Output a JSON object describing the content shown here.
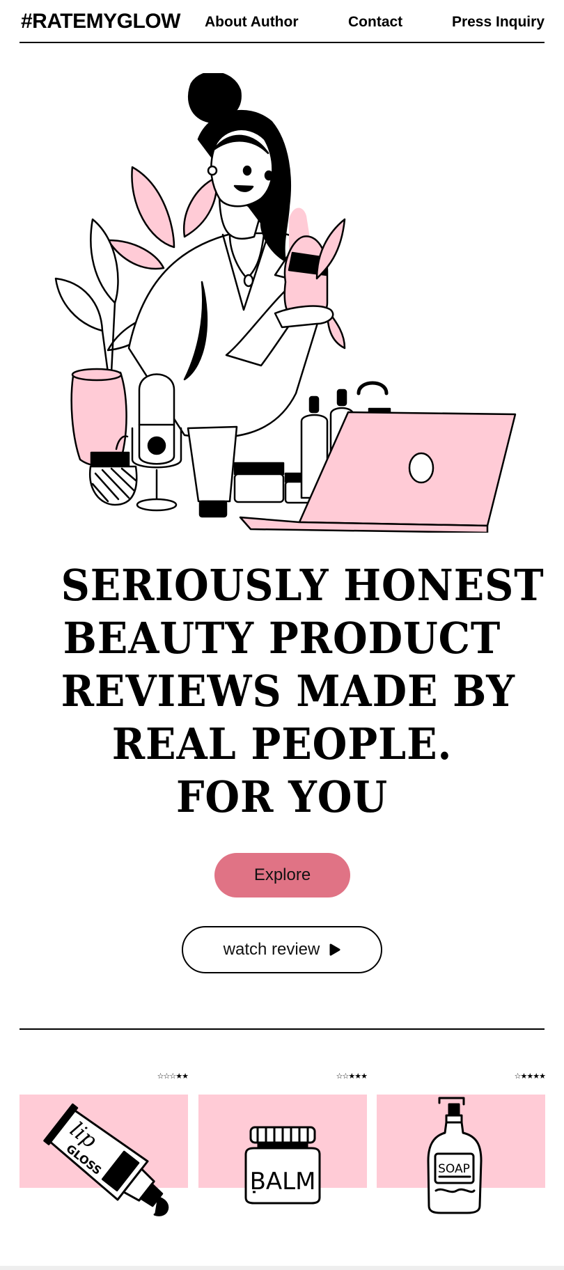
{
  "header": {
    "brand": "#RATEMYGLOW",
    "nav": [
      "About Author",
      "Contact",
      "Press Inquiry"
    ]
  },
  "headline": {
    "lines": [
      "SERIOUSLY HONEST",
      "BEAUTY PRODUCT",
      "REVIEWS MADE BY",
      "REAL PEOPLE.",
      "FOR YOU"
    ]
  },
  "actions": {
    "explore_label": "Explore",
    "watch_label": "watch review"
  },
  "products": [
    {
      "label_art": "lip gloss",
      "rating": 2,
      "max_rating": 5
    },
    {
      "label_art": "BALM",
      "rating": 3,
      "max_rating": 5
    },
    {
      "label_art": "SOAP",
      "rating": 4,
      "max_rating": 5
    }
  ],
  "colors": {
    "accent_pink": "#ffcbd6",
    "button_pink": "#e07385",
    "text": "#000000"
  },
  "icons": {
    "play": "play-icon",
    "star": "star-icon"
  }
}
